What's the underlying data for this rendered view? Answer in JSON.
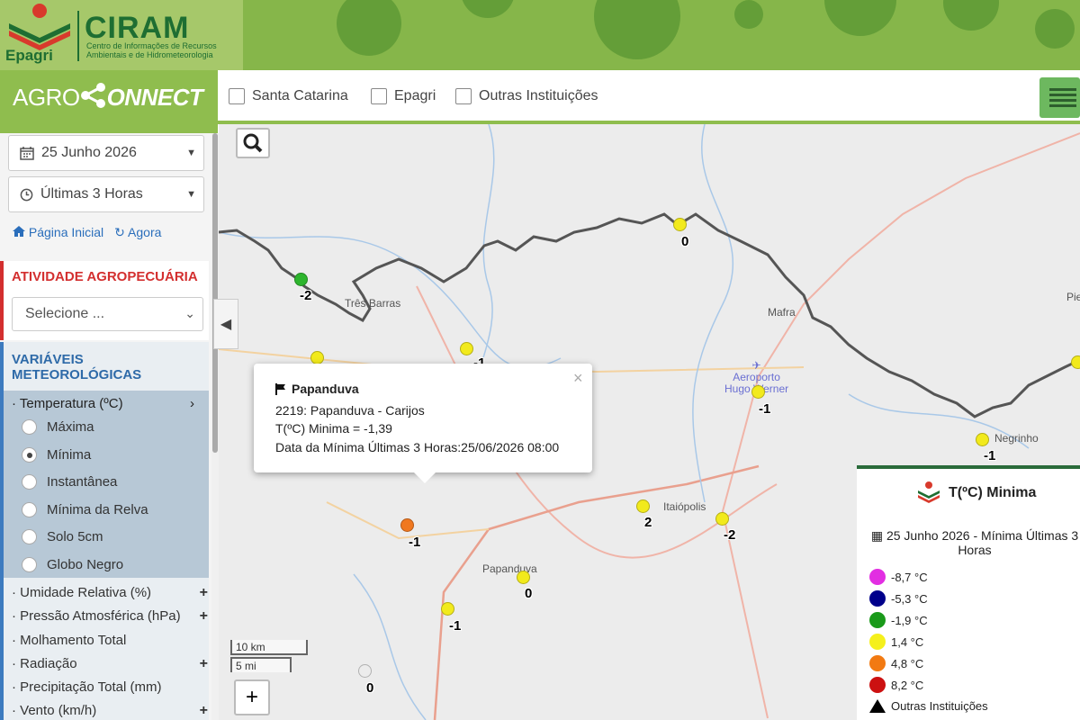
{
  "header": {
    "brand": "Epagri",
    "title": "CIRAM",
    "subtitle": "Centro de Informações de Recursos Ambientais e de Hidrometeorologia",
    "app_logo_a": "AGRO",
    "app_logo_b": "ONNECT"
  },
  "filters": [
    {
      "label": "Santa Catarina",
      "checked": false
    },
    {
      "label": "Epagri",
      "checked": false
    },
    {
      "label": "Outras Instituições",
      "checked": false
    }
  ],
  "sidebar": {
    "date": "25 Junho 2026",
    "period": "Últimas 3 Horas",
    "home_link": "Página Inicial",
    "now_link": "Agora",
    "atividade_title": "ATIVIDADE AGROPECUÁRIA",
    "atividade_placeholder": "Selecione ...",
    "vars_title_1": "VARIÁVEIS",
    "vars_title_2": "METEOROLÓGICAS",
    "temperature": {
      "label": "· Temperatura (ºC)",
      "options": [
        "Máxima",
        "Mínima",
        "Instantânea",
        "Mínima da Relva",
        "Solo 5cm",
        "Globo Negro"
      ],
      "selected": "Mínima"
    },
    "other_vars": [
      {
        "label": "· Umidade Relativa (%)",
        "expand": "+"
      },
      {
        "label": "· Pressão Atmosférica (hPa)",
        "expand": "+"
      },
      {
        "label": "· Molhamento Total",
        "expand": ""
      },
      {
        "label": "· Radiação",
        "expand": "+"
      },
      {
        "label": "· Precipitação Total (mm)",
        "expand": ""
      },
      {
        "label": "· Vento (km/h)",
        "expand": "+"
      }
    ]
  },
  "map": {
    "places": {
      "tres_barras": "Três Barras",
      "mafra": "Mafra",
      "airport_1": "Aeroporto",
      "airport_2": "Hugo Werner",
      "negrinho": "Negrinho",
      "itaiopolis": "Itaiópolis",
      "papanduva": "Papanduva",
      "pie": "Pie"
    },
    "stations": [
      {
        "label": "0",
        "color": "#f2ea1c"
      },
      {
        "label": "-2",
        "color": "#2db52d"
      },
      {
        "label": "-1",
        "color": "#f2ea1c"
      },
      {
        "label": "-1",
        "color": "#f2ea1c"
      },
      {
        "label": "-1",
        "color": "#f2ea1c"
      },
      {
        "label": "-1",
        "color": "#f2ea1c"
      },
      {
        "label": "2",
        "color": "#f07820"
      },
      {
        "label": "-2",
        "color": "#f2ea1c"
      },
      {
        "label": "-1",
        "color": "#f2ea1c"
      },
      {
        "label": "0",
        "color": "#f2ea1c"
      },
      {
        "label": "-1",
        "color": "#f2ea1c"
      },
      {
        "label": "0",
        "color": "#f2ea1c"
      }
    ],
    "scale_km": "10 km",
    "scale_mi": "5 mi",
    "zoom_in": "+"
  },
  "popup": {
    "title": "Papanduva",
    "line1": "2219: Papanduva - Carijos",
    "line2": "T(ºC) Minima = -1,39",
    "line3": "Data da Mínima Últimas 3 Horas:25/06/2026 08:00",
    "close": "×"
  },
  "legend": {
    "title": "T(ºC) Minima",
    "date_line": "25 Junho 2026 - Mínima Últimas 3 Horas",
    "items": [
      {
        "label": "-8,7 °C",
        "color": "#e22ee2"
      },
      {
        "label": "-5,3 °C",
        "color": "#00008b"
      },
      {
        "label": "-1,9 °C",
        "color": "#1a9a1a"
      },
      {
        "label": "1,4 °C",
        "color": "#f5f01c"
      },
      {
        "label": "4,8 °C",
        "color": "#f27a12"
      },
      {
        "label": "8,2 °C",
        "color": "#cc1111"
      }
    ],
    "other": "Outras Instituições"
  }
}
